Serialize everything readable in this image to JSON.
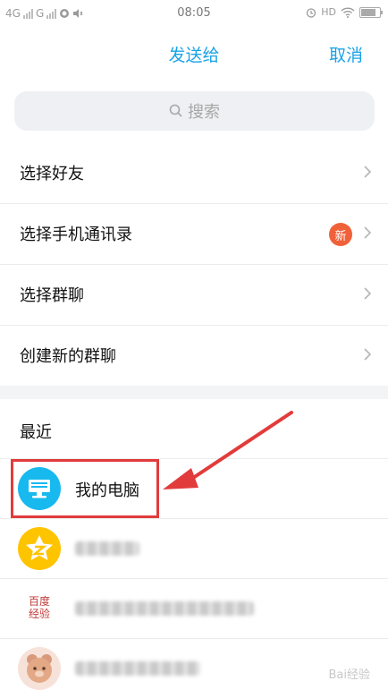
{
  "status_bar": {
    "net1": "4G",
    "net2": "G",
    "time": "08:05",
    "hd": "HD"
  },
  "header": {
    "title": "发送给",
    "cancel": "取消"
  },
  "search": {
    "placeholder": "搜索"
  },
  "menu": [
    {
      "label": "选择好友"
    },
    {
      "label": "选择手机通讯录",
      "badge": "新"
    },
    {
      "label": "选择群聊"
    },
    {
      "label": "创建新的群聊"
    }
  ],
  "recent": {
    "title": "最近",
    "first_contact": "我的电脑",
    "avatar_text": "百度\n经验"
  },
  "watermark": "Bai经验",
  "colors": {
    "accent": "#1aa3e8",
    "badge": "#f0613a",
    "annotation": "#e23b3b",
    "computer_avatar": "#18b9ef",
    "qzone_avatar": "#ffc400"
  }
}
